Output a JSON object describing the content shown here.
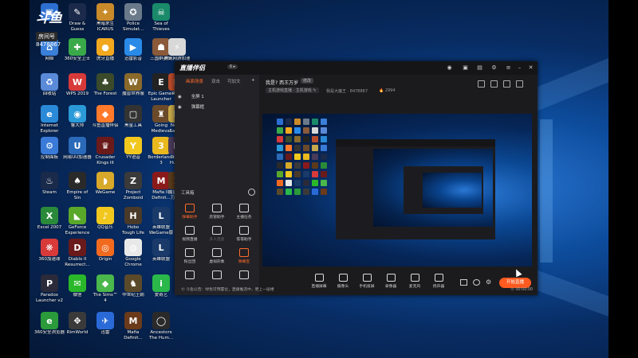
{
  "watermark": {
    "logo": "斗鱼",
    "room_label": "房间号",
    "room_number": "8478867"
  },
  "desktop_icons": [
    {
      "label": "",
      "color": "#2d6fd1",
      "glyph": "▣"
    },
    {
      "label": "Draw &\nGuess",
      "color": "#1b2a4a",
      "glyph": "✎"
    },
    {
      "label": "黑暗求生\nICARUS",
      "color": "#c98a2a",
      "glyph": "✦"
    },
    {
      "label": "Police\nSimulat...",
      "color": "#6a7a8a",
      "glyph": "✪"
    },
    {
      "label": "Sea of\nThieves",
      "color": "#1a8a6a",
      "glyph": "☠"
    },
    {
      "label": "网络",
      "color": "#3a7fd8",
      "glyph": "⌂"
    },
    {
      "label": "360安全卫士",
      "color": "#3aa94a",
      "glyph": "✚"
    },
    {
      "label": "虎牙直播",
      "color": "#f2a81e",
      "glyph": "●"
    },
    {
      "label": "迅雷影音",
      "color": "#2a8ae8",
      "glyph": "▶"
    },
    {
      "label": "三国群英传",
      "color": "#8a5a3a",
      "glyph": "☗"
    },
    {
      "label": "腾讯网游加速",
      "color": "#d8d8d8",
      "glyph": "⚡"
    },
    {
      "label": "回收站",
      "color": "#5a8ad8",
      "glyph": "♻"
    },
    {
      "label": "WPS 2019",
      "color": "#d83a3a",
      "glyph": "W"
    },
    {
      "label": "The Forest",
      "color": "#3a4a2a",
      "glyph": "♣"
    },
    {
      "label": "魔兽世界服",
      "color": "#8a6a2a",
      "glyph": "W"
    },
    {
      "label": "Epic Games\nLauncher",
      "color": "#222222",
      "glyph": "E"
    },
    {
      "label": "Ru...",
      "color": "#b84a2a",
      "glyph": "R"
    },
    {
      "label": "Internet\nExplorer",
      "color": "#2a8ad8",
      "glyph": "e"
    },
    {
      "label": "鲁大师",
      "color": "#2a9ad8",
      "glyph": "◉"
    },
    {
      "label": "斗鱼直播伴侣",
      "color": "#ff7a2a",
      "glyph": "◆"
    },
    {
      "label": "黑金工具",
      "color": "#333333",
      "glyph": "▢"
    },
    {
      "label": "Going\nMedieval",
      "color": "#6a4a2a",
      "glyph": "♜"
    },
    {
      "label": "Nob...\nSave...",
      "color": "#c8a84a",
      "glyph": "N"
    },
    {
      "label": "控制面板",
      "color": "#3a7ad8",
      "glyph": "⚙"
    },
    {
      "label": "网易UU加速器",
      "color": "#2a6ab8",
      "glyph": "U"
    },
    {
      "label": "Crusader\nKings III",
      "color": "#6a1a1a",
      "glyph": "♛"
    },
    {
      "label": "YY语音",
      "color": "#f2c81e",
      "glyph": "Y"
    },
    {
      "label": "Borderlands\n3",
      "color": "#e8b81e",
      "glyph": "3"
    },
    {
      "label": "Divi...\nHum...",
      "color": "#4a3a5a",
      "glyph": "D"
    },
    {
      "label": "Steam",
      "color": "#1a2a4a",
      "glyph": "♨"
    },
    {
      "label": "Empire of\nSin",
      "color": "#2a2a2a",
      "glyph": "♠"
    },
    {
      "label": "WeGame",
      "color": "#d8a82a",
      "glyph": "◗"
    },
    {
      "label": "Project\nZomboid",
      "color": "#3a3a3a",
      "glyph": "Z"
    },
    {
      "label": "Mafia III\nDefinit...",
      "color": "#8a1a1a",
      "glyph": "M"
    },
    {
      "label": "魔兽争霸\n万族...",
      "color": "#5a3a1a",
      "glyph": "⚔"
    },
    {
      "label": "Excel 2007",
      "color": "#2a8a3a",
      "glyph": "X"
    },
    {
      "label": "GeForce\nExperience",
      "color": "#5aa82a",
      "glyph": "◣"
    },
    {
      "label": "QQ音乐",
      "color": "#f2c81e",
      "glyph": "♪"
    },
    {
      "label": "Hobo\nTough Life",
      "color": "#4a3a2a",
      "glyph": "H"
    },
    {
      "label": "英雄联盟\nWeGame版",
      "color": "#1a3a6a",
      "glyph": "L"
    },
    {
      "label": "360加速球",
      "color": "#d83a3a",
      "glyph": "❋"
    },
    {
      "label": "Diablo II\nResurrect...",
      "color": "#6a1a1a",
      "glyph": "D"
    },
    {
      "label": "Origin",
      "color": "#f26a1e",
      "glyph": "◎"
    },
    {
      "label": "Google\nChrome",
      "color": "#e8e8e8",
      "glyph": "◍"
    },
    {
      "label": "英雄联盟",
      "color": "#1a3a6a",
      "glyph": "L"
    },
    {
      "label": "Paradox\nLauncher v2",
      "color": "#2a2a3a",
      "glyph": "P"
    },
    {
      "label": "微信",
      "color": "#2ab82a",
      "glyph": "✉"
    },
    {
      "label": "The Sims™\n4",
      "color": "#4ab84a",
      "glyph": "◆"
    },
    {
      "label": "中世纪王朝",
      "color": "#5a4a2a",
      "glyph": "♞"
    },
    {
      "label": "爱奇艺",
      "color": "#2ab84a",
      "glyph": "i"
    },
    {
      "label": "360安全浏览器",
      "color": "#2a9a3a",
      "glyph": "e"
    },
    {
      "label": "RimWorld",
      "color": "#3a3a3a",
      "glyph": "✥"
    },
    {
      "label": "迅雷",
      "color": "#2a6ad8",
      "glyph": "✈"
    },
    {
      "label": "Mafia\nDefinit...",
      "color": "#6a3a1a",
      "glyph": "M"
    },
    {
      "label": "Ancestors\nThe Hum...",
      "color": "#2a2a2a",
      "glyph": "◯"
    }
  ],
  "app": {
    "logo": "直播伴侣",
    "version": "6 ▸",
    "left_tabs": [
      "画面场景",
      "双击",
      "可加文"
    ],
    "scenes": [
      "全屏 1",
      "弹幕框"
    ],
    "tools_title": "工具箱",
    "tools": [
      {
        "label": "弹幕助手",
        "hot": true,
        "dim": false
      },
      {
        "label": "房管助手",
        "hot": false,
        "dim": false
      },
      {
        "label": "主播任务",
        "hot": false,
        "dim": false
      },
      {
        "label": "视频直播",
        "hot": false,
        "dim": false
      },
      {
        "label": "多人连麦",
        "hot": false,
        "dim": true
      },
      {
        "label": "等等助手",
        "hot": false,
        "dim": false
      },
      {
        "label": "粉丝团",
        "hot": false,
        "dim": false
      },
      {
        "label": "虚拟形象",
        "hot": false,
        "dim": false
      },
      {
        "label": "弹幕宝",
        "hot": true,
        "dim": false
      },
      {
        "label": "",
        "hot": false,
        "dim": false
      },
      {
        "label": "",
        "hot": false,
        "dim": false
      },
      {
        "label": "",
        "hot": false,
        "dim": false
      }
    ],
    "room_title": "我是? 西王万岁",
    "room_edit": "修改",
    "room_category": "主机游戏直播 · 主机游戏 ✎",
    "room_info": "我是大魔王 · 8478867",
    "room_hot": "🔥 2994",
    "bottom_buttons": [
      "直播屏幕",
      "摄像头",
      "手机投屏",
      "录像器",
      "麦克风",
      "扬声器"
    ],
    "start_label": "开始直播",
    "status_left": "⓪ 斗鱼公告：绿色可预置位，直播推流中，更上一层楼",
    "status_right": "⓪ 00:00:00"
  },
  "colors": {
    "accent": "#ff5a1f",
    "window_bg": "#1e1e22",
    "desktop_blue": "#0d4c9c"
  }
}
